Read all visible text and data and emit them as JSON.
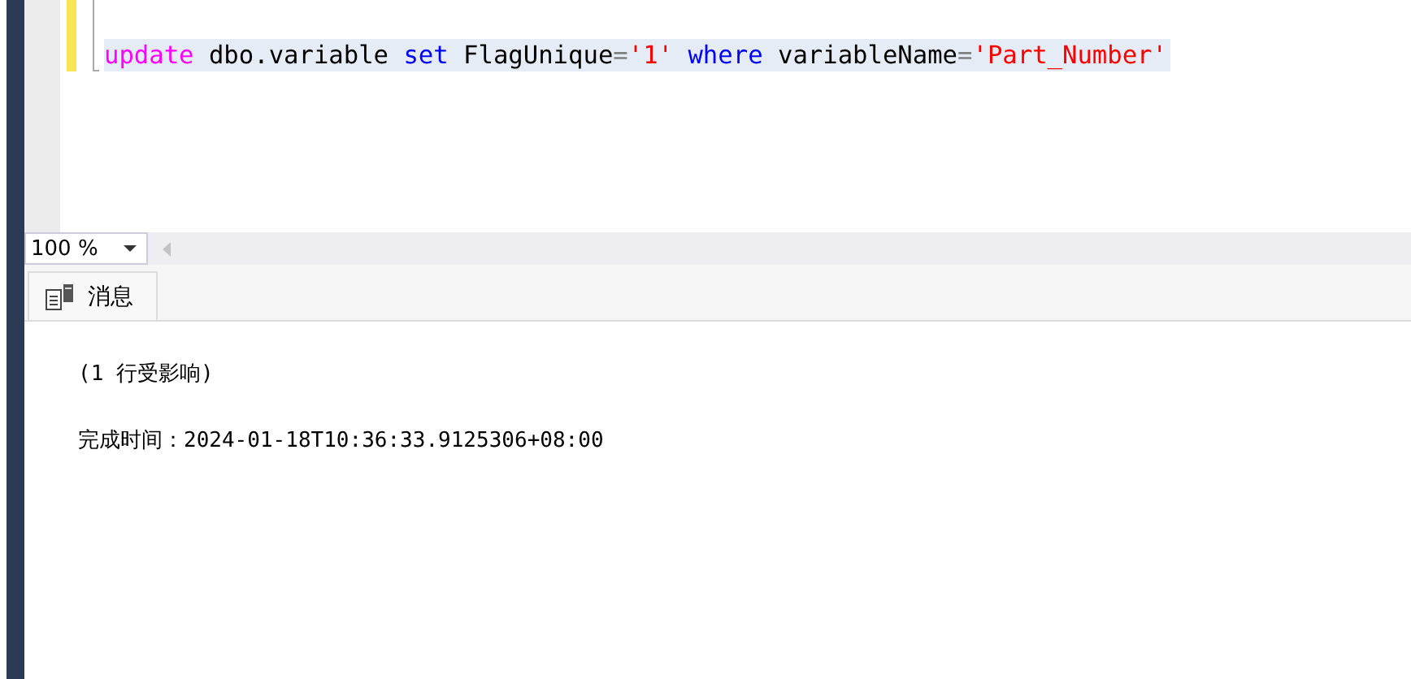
{
  "editor": {
    "code_line": [
      {
        "kind": "function",
        "text": "update"
      },
      {
        "kind": "plain",
        "text": " dbo.variable "
      },
      {
        "kind": "keyword",
        "text": "set"
      },
      {
        "kind": "plain",
        "text": " FlagUnique"
      },
      {
        "kind": "operator",
        "text": "="
      },
      {
        "kind": "string",
        "text": "'1'"
      },
      {
        "kind": "keyword",
        "text": " where"
      },
      {
        "kind": "plain",
        "text": " variableName"
      },
      {
        "kind": "operator",
        "text": "="
      },
      {
        "kind": "string",
        "text": "'Part_Number'"
      }
    ]
  },
  "zoom": {
    "value": "100 %"
  },
  "tabs": [
    {
      "label": "消息",
      "selected": true
    }
  ],
  "messages": [
    "(1 行受影响)",
    "完成时间：2024-01-18T10:36:33.9125306+08:00"
  ]
}
